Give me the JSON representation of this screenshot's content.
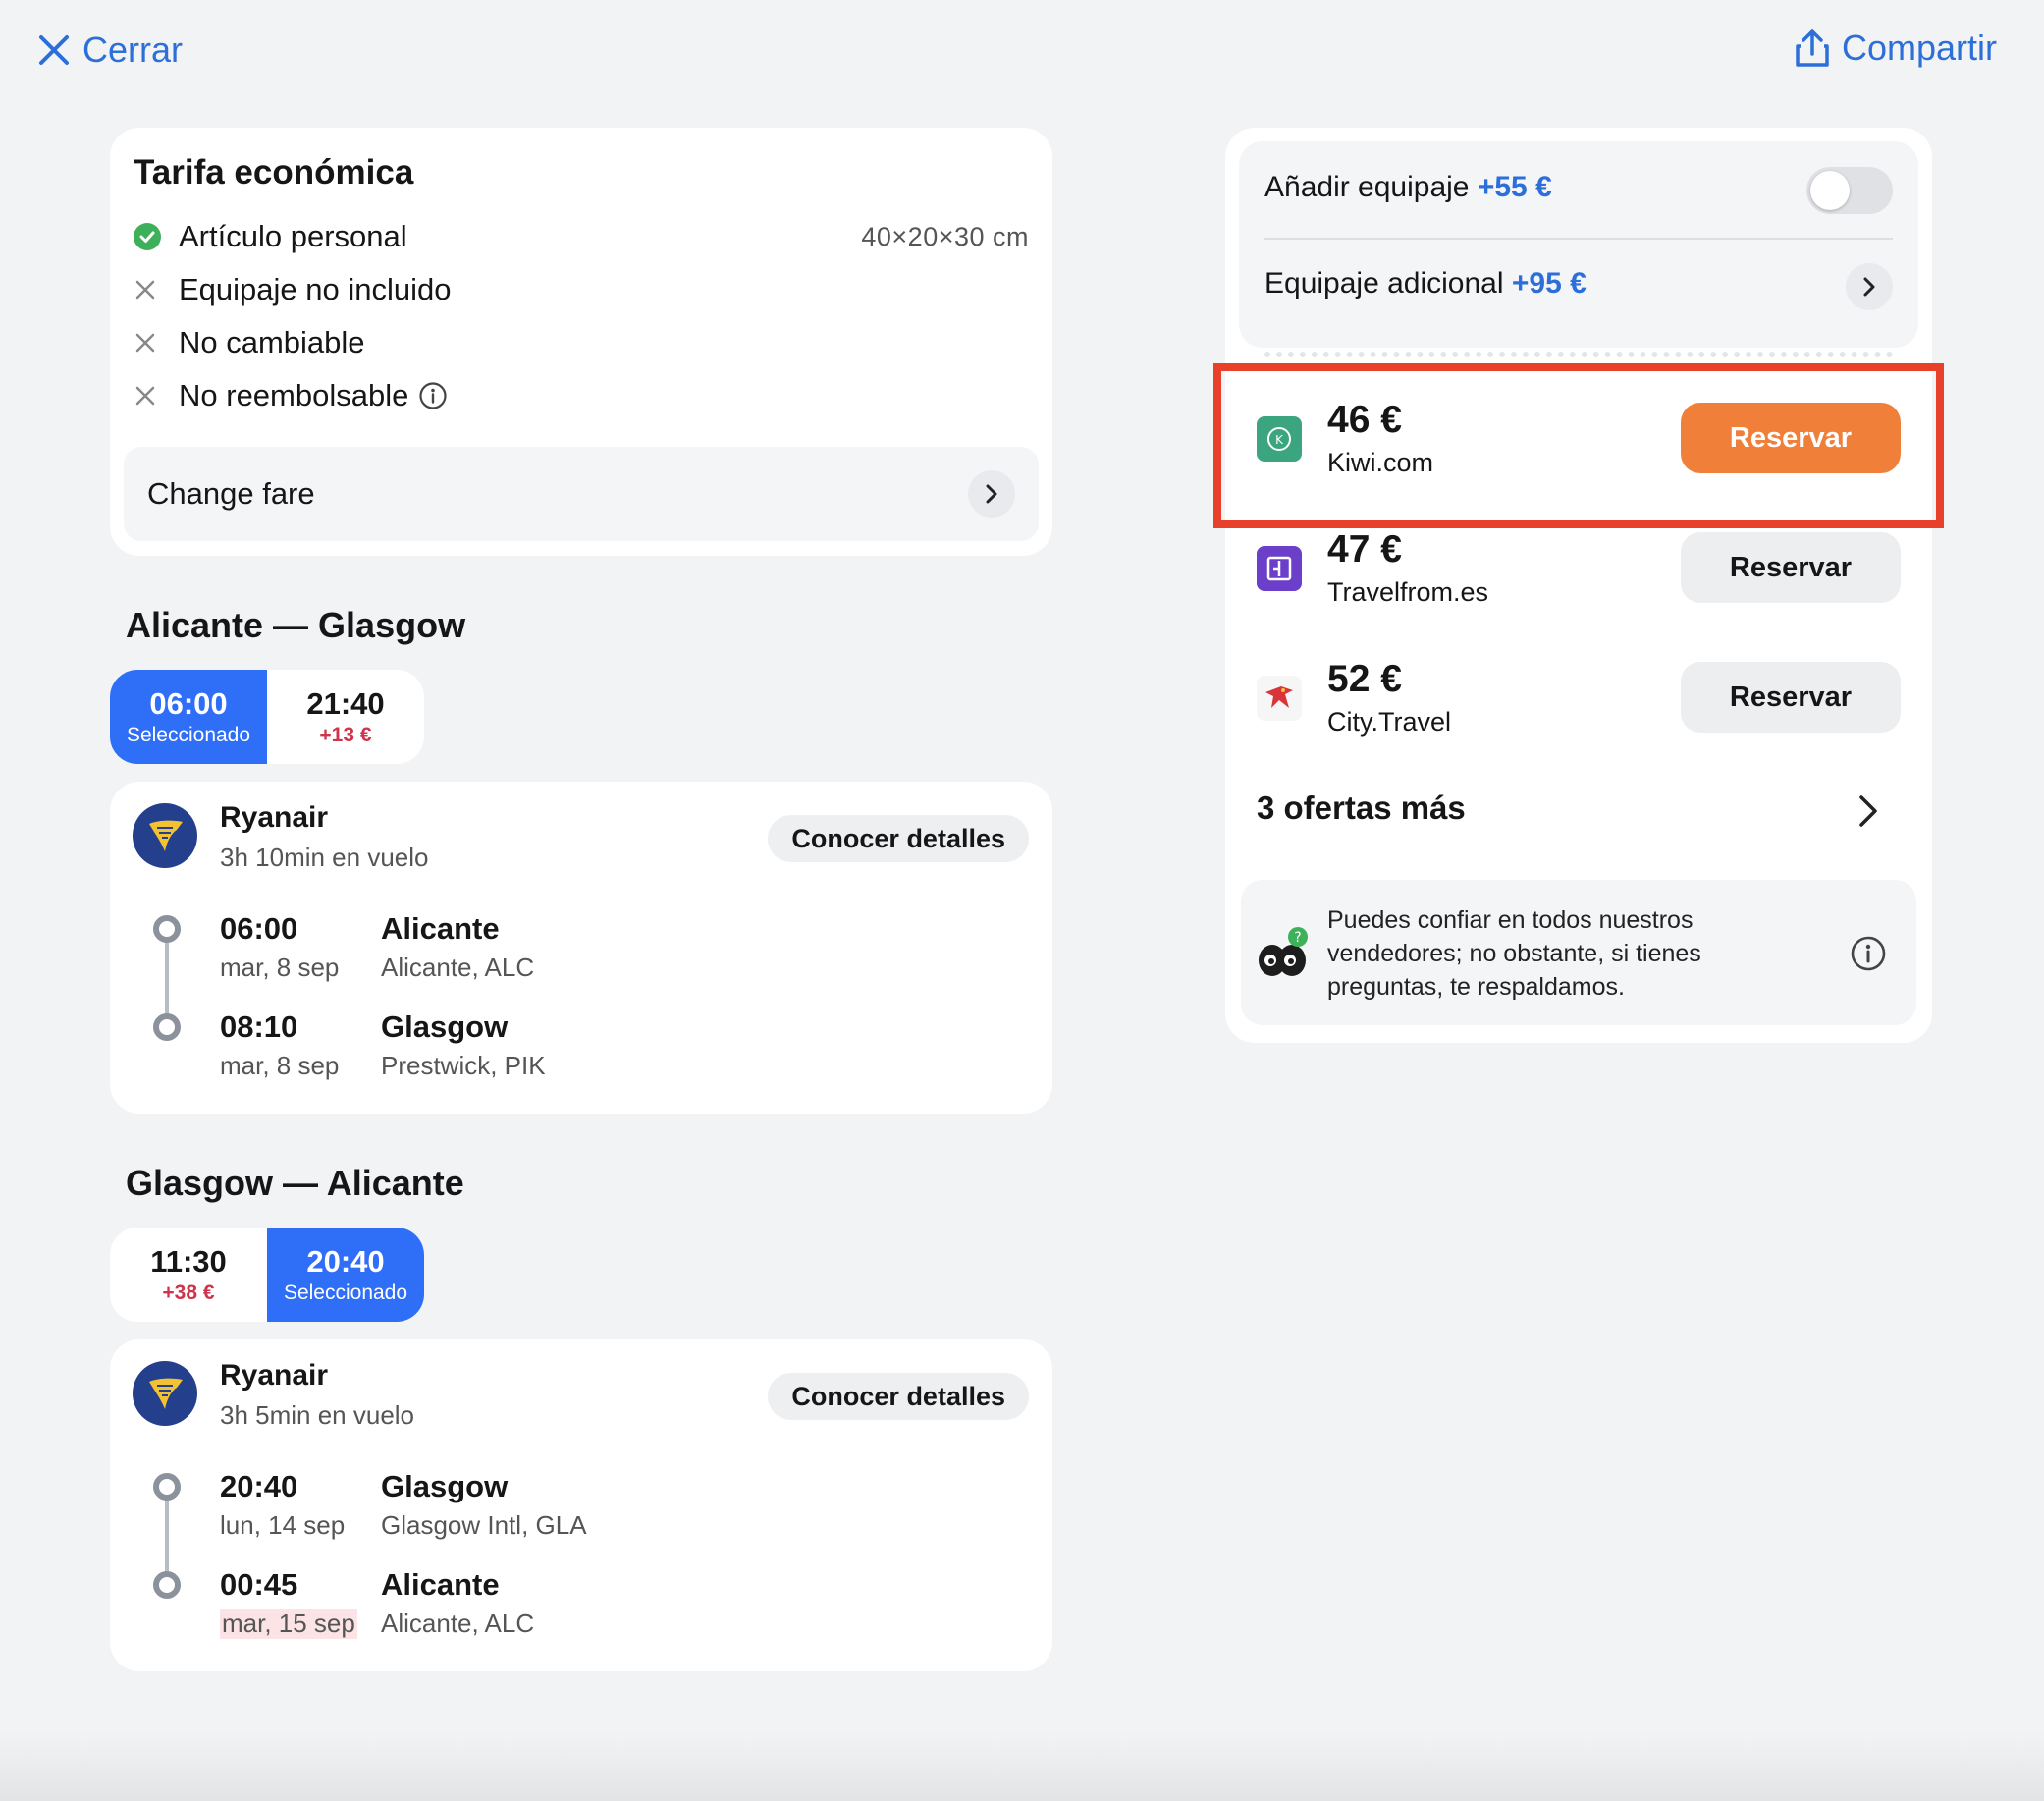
{
  "topbar": {
    "close_label": "Cerrar",
    "share_label": "Compartir"
  },
  "fare": {
    "title": "Tarifa económica",
    "items": [
      {
        "label": "Artículo personal",
        "detail": "40×20×30 cm",
        "included": true
      },
      {
        "label": "Equipaje no incluido",
        "included": false
      },
      {
        "label": "No cambiable",
        "included": false
      },
      {
        "label": "No reembolsable",
        "included": false
      }
    ],
    "change_fare_label": "Change fare"
  },
  "outbound": {
    "route": "Alicante — Glasgow",
    "options": [
      {
        "time": "06:00",
        "note": "Seleccionado",
        "selected": true
      },
      {
        "time": "21:40",
        "note": "+13 €",
        "selected": false
      }
    ],
    "airline": "Ryanair",
    "duration": "3h 10min en vuelo",
    "details_label": "Conocer detalles",
    "departure": {
      "time": "06:00",
      "date": "mar, 8 sep",
      "city": "Alicante",
      "airport": "Alicante, ALC"
    },
    "arrival": {
      "time": "08:10",
      "date": "mar, 8 sep",
      "city": "Glasgow",
      "airport": "Prestwick, PIK"
    }
  },
  "inbound": {
    "route": "Glasgow — Alicante",
    "options": [
      {
        "time": "11:30",
        "note": "+38 €",
        "selected": false
      },
      {
        "time": "20:40",
        "note": "Seleccionado",
        "selected": true
      }
    ],
    "airline": "Ryanair",
    "duration": "3h 5min en vuelo",
    "details_label": "Conocer detalles",
    "departure": {
      "time": "20:40",
      "date": "lun, 14 sep",
      "city": "Glasgow",
      "airport": "Glasgow Intl, GLA"
    },
    "arrival": {
      "time": "00:45",
      "date": "mar, 15 sep",
      "city": "Alicante",
      "airport": "Alicante, ALC"
    }
  },
  "extras": {
    "add_baggage_label": "Añadir equipaje",
    "add_baggage_price": "+55 €",
    "extra_baggage_label": "Equipaje adicional",
    "extra_baggage_price": "+95 €"
  },
  "providers": [
    {
      "price": "46 €",
      "name": "Kiwi.com",
      "button": "Reservar",
      "highlighted": true,
      "logo_color": "#3aa57e"
    },
    {
      "price": "47 €",
      "name": "Travelfrom.es",
      "button": "Reservar",
      "highlighted": false,
      "logo_color": "#6b3fc9"
    },
    {
      "price": "52 €",
      "name": "City.Travel",
      "button": "Reservar",
      "highlighted": false,
      "logo_color": "#d8343a"
    }
  ],
  "more_offers_label": "3 ofertas más",
  "trust_text": "Puedes confiar en todos nuestros vendedores; no obstante, si tienes preguntas, te respaldamos.",
  "colors": {
    "accent_blue": "#2d6fd8",
    "selected_blue": "#2f6ef6",
    "book_orange": "#f07f39",
    "highlight_red": "#e8402a",
    "surcharge_red": "#d0334a"
  }
}
